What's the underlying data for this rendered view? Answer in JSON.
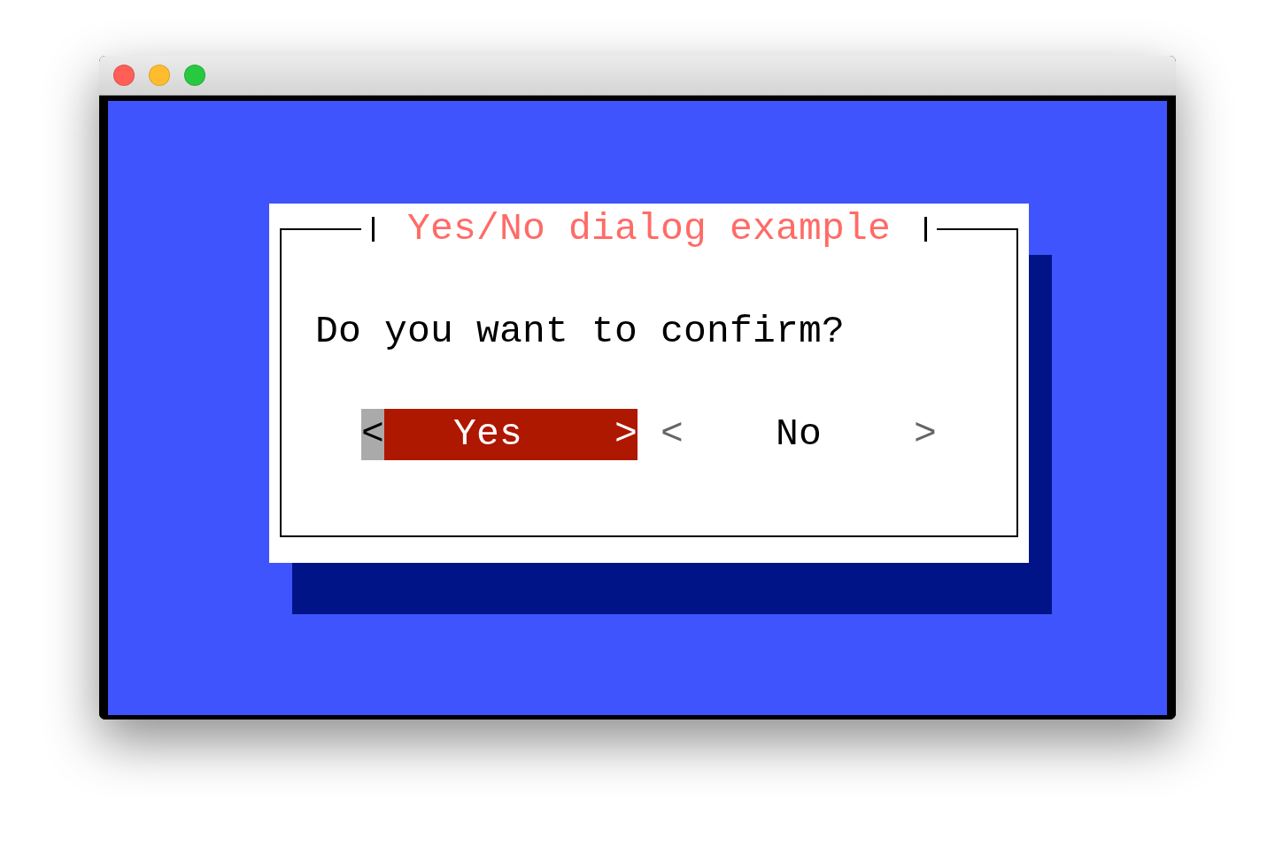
{
  "dialog": {
    "title": "Yes/No dialog example",
    "message": "Do you want to confirm?",
    "buttons": [
      {
        "open_mark": "<",
        "label": "Yes",
        "close_mark": ">",
        "selected": true
      },
      {
        "open_mark": "<",
        "label": "No",
        "close_mark": ">",
        "selected": false
      }
    ]
  }
}
